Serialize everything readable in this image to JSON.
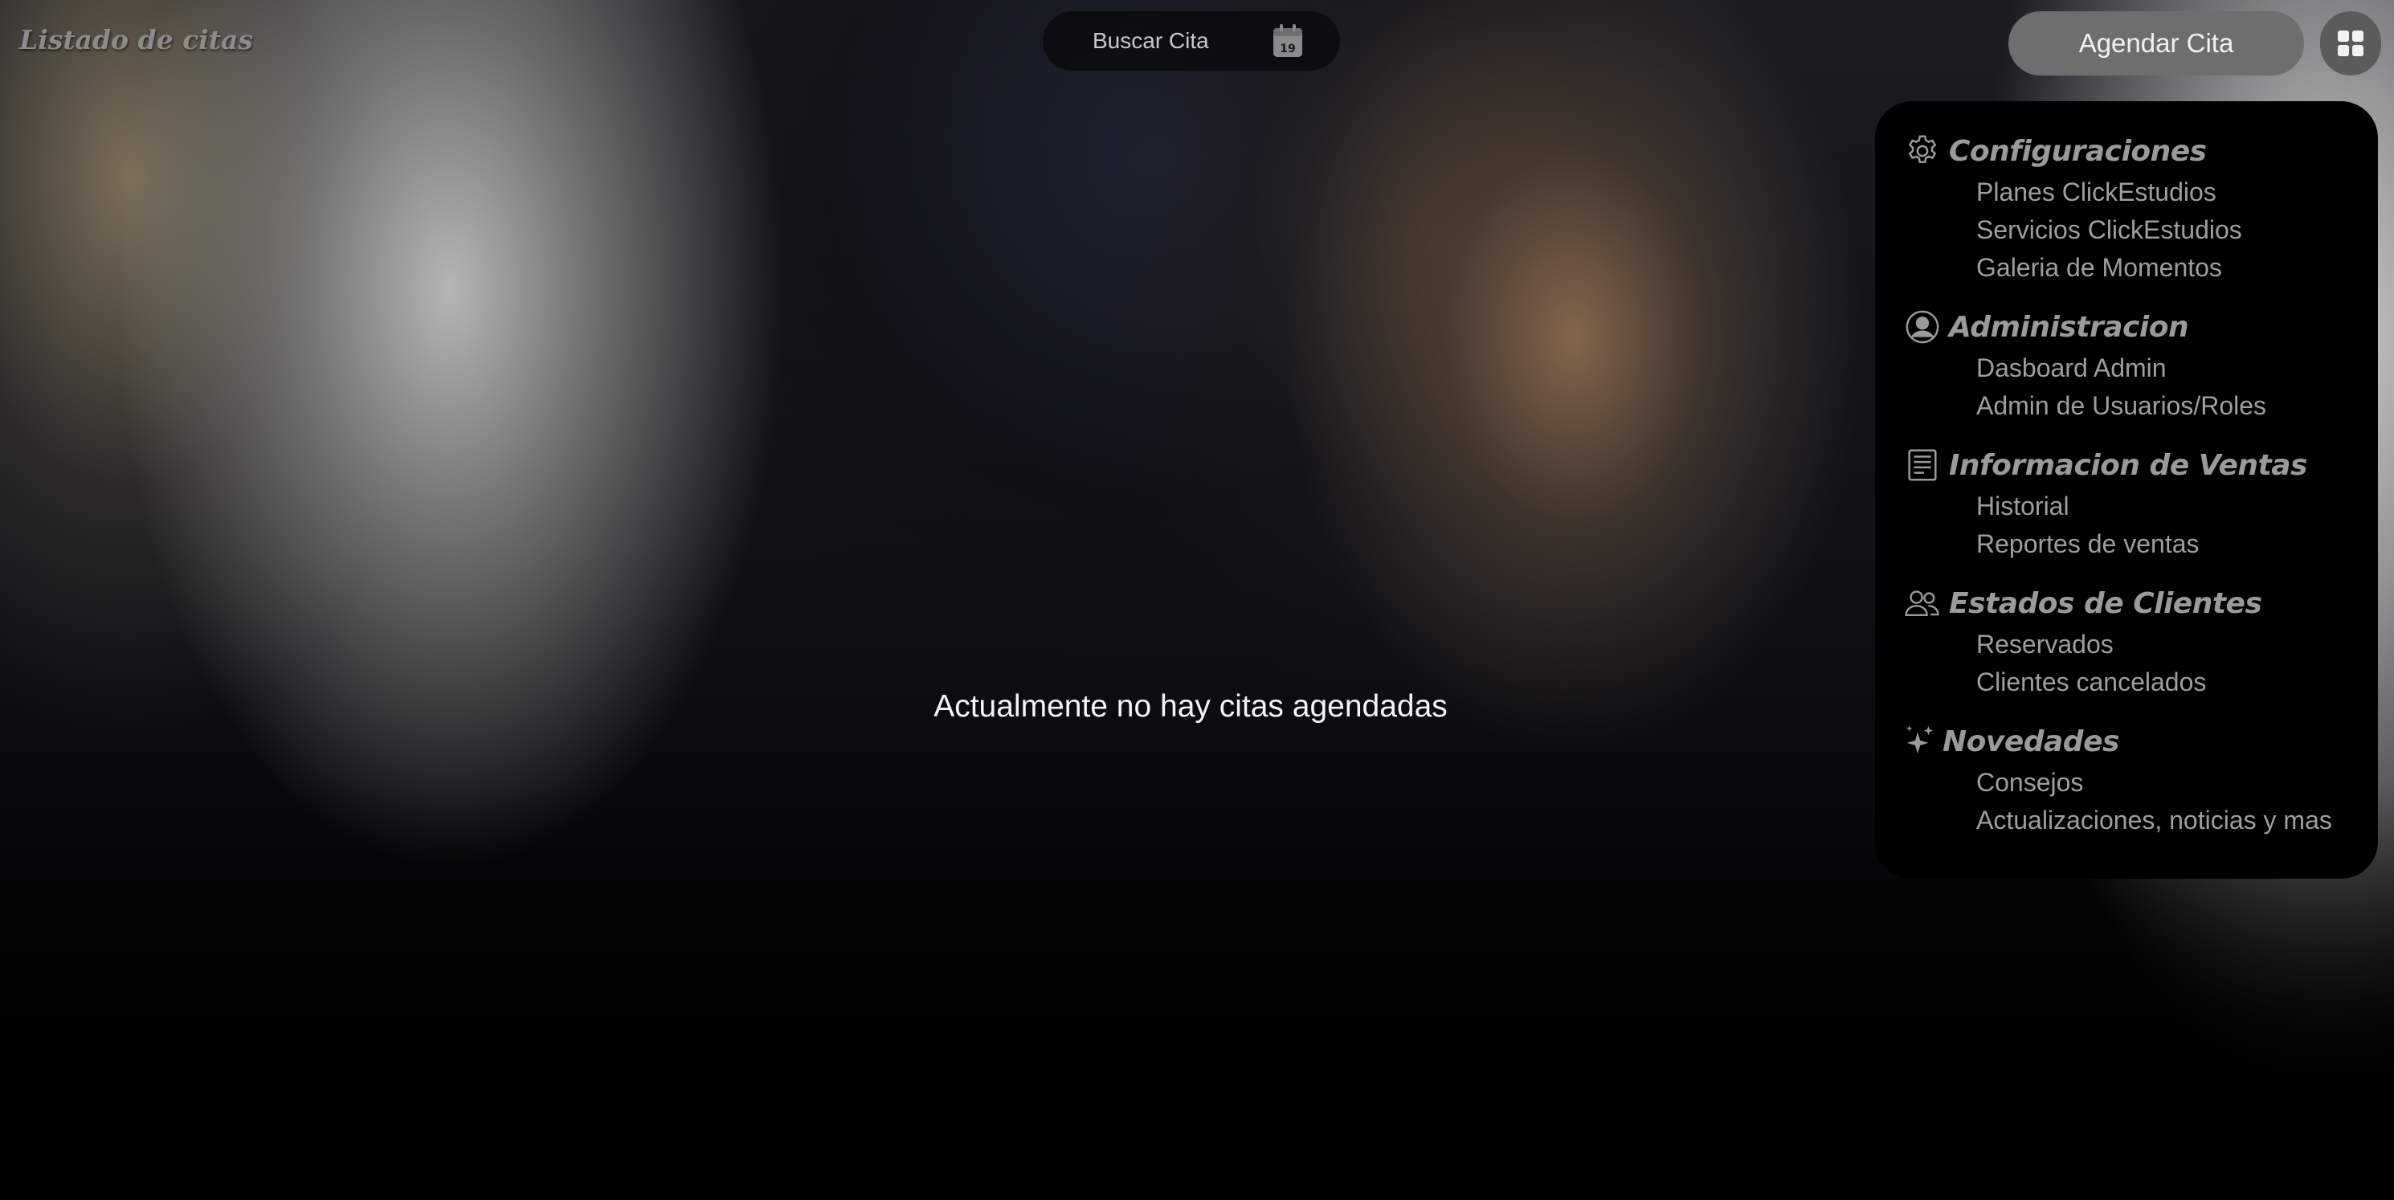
{
  "header": {
    "title": "Listado de citas",
    "search_label": "Buscar Cita",
    "calendar_day": "19",
    "agendar_label": "Agendar Cita"
  },
  "main": {
    "empty_message": "Actualmente no hay citas agendadas"
  },
  "menu": {
    "sections": [
      {
        "title": "Configuraciones",
        "icon": "gear-icon",
        "items": [
          "Planes ClickEstudios",
          "Servicios ClickEstudios",
          "Galeria de Momentos"
        ]
      },
      {
        "title": "Administracion",
        "icon": "user-circle-icon",
        "items": [
          "Dasboard Admin",
          "Admin de Usuarios/Roles"
        ]
      },
      {
        "title": "Informacion de Ventas",
        "icon": "receipt-icon",
        "items": [
          "Historial",
          "Reportes de ventas"
        ]
      },
      {
        "title": "Estados de Clientes",
        "icon": "users-icon",
        "items": [
          "Reservados",
          "Clientes cancelados"
        ]
      },
      {
        "title": "Novedades",
        "icon": "sparkles-icon",
        "items": [
          "Consejos",
          "Actualizaciones, noticias y mas"
        ]
      }
    ]
  },
  "colors": {
    "menu_background": "#000000",
    "menu_text": "#9e9e9e",
    "button_background": "#6e6e6e",
    "message_text": "#f4f4f4"
  }
}
